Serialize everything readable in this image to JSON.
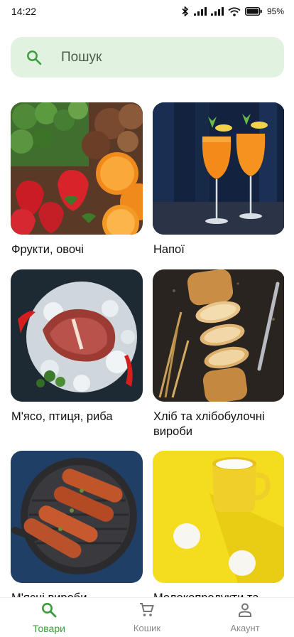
{
  "status_bar": {
    "time": "14:22",
    "battery": "95"
  },
  "search": {
    "placeholder": "Пошук"
  },
  "categories": [
    {
      "label": "Фрукти, овочі",
      "image": "fruits-vegetables-photo"
    },
    {
      "label": "Напої",
      "image": "drinks-photo"
    },
    {
      "label": "М'ясо, птиця, риба",
      "image": "meat-fish-photo"
    },
    {
      "label": "Хліб та хлібобулочні вироби",
      "image": "bread-photo"
    },
    {
      "label": "М'ясні вироби",
      "image": "sausages-photo"
    },
    {
      "label": "Молокопродукти та",
      "image": "dairy-eggs-photo"
    }
  ],
  "bottom_nav": {
    "items": [
      {
        "label": "Товари",
        "icon": "search-icon",
        "active": true
      },
      {
        "label": "Кошик",
        "icon": "cart-icon",
        "active": false
      },
      {
        "label": "Акаунт",
        "icon": "account-icon",
        "active": false
      }
    ]
  },
  "colors": {
    "accent": "#3c9c3c",
    "search_bg": "#e2f2e0"
  }
}
